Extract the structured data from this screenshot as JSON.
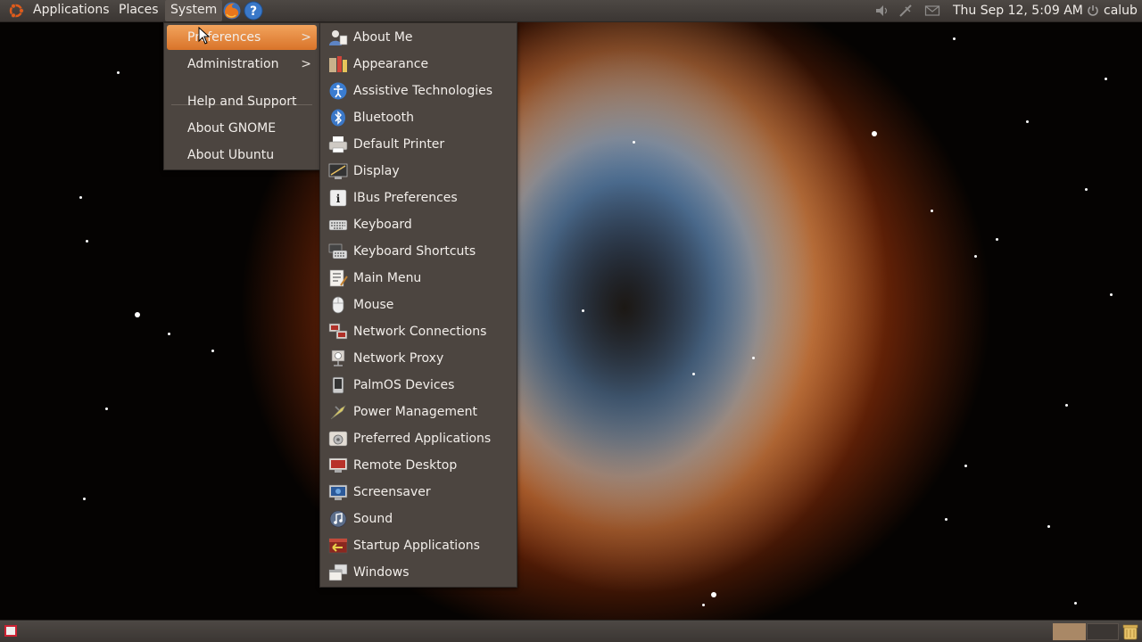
{
  "top_panel": {
    "menus": {
      "applications": "Applications",
      "places": "Places",
      "system": "System"
    },
    "clock": "Thu Sep 12,  5:09 AM",
    "user": "calub"
  },
  "system_menu": {
    "items": [
      {
        "label": "Preferences",
        "has_submenu": true,
        "highlighted": true
      },
      {
        "label": "Administration",
        "has_submenu": true
      },
      {
        "label": "Help and Support"
      },
      {
        "label": "About GNOME"
      },
      {
        "label": "About Ubuntu"
      }
    ],
    "submenu_arrow": ">"
  },
  "preferences_menu": {
    "items": [
      {
        "label": "About Me",
        "icon": "user-icon"
      },
      {
        "label": "Appearance",
        "icon": "appearance-icon"
      },
      {
        "label": "Assistive Technologies",
        "icon": "accessibility-icon"
      },
      {
        "label": "Bluetooth",
        "icon": "bluetooth-icon"
      },
      {
        "label": "Default Printer",
        "icon": "printer-icon"
      },
      {
        "label": "Display",
        "icon": "display-icon"
      },
      {
        "label": "IBus Preferences",
        "icon": "ibus-icon"
      },
      {
        "label": "Keyboard",
        "icon": "keyboard-icon"
      },
      {
        "label": "Keyboard Shortcuts",
        "icon": "keyboard-shortcuts-icon"
      },
      {
        "label": "Main Menu",
        "icon": "main-menu-icon"
      },
      {
        "label": "Mouse",
        "icon": "mouse-icon"
      },
      {
        "label": "Network Connections",
        "icon": "network-connections-icon"
      },
      {
        "label": "Network Proxy",
        "icon": "network-proxy-icon"
      },
      {
        "label": "PalmOS Devices",
        "icon": "palm-device-icon"
      },
      {
        "label": "Power Management",
        "icon": "power-management-icon"
      },
      {
        "label": "Preferred Applications",
        "icon": "preferred-apps-icon"
      },
      {
        "label": "Remote Desktop",
        "icon": "remote-desktop-icon"
      },
      {
        "label": "Screensaver",
        "icon": "screensaver-icon"
      },
      {
        "label": "Sound",
        "icon": "sound-icon"
      },
      {
        "label": "Startup Applications",
        "icon": "startup-apps-icon"
      },
      {
        "label": "Windows",
        "icon": "windows-icon"
      }
    ]
  },
  "colors": {
    "panel": "#3b3633",
    "menu_bg": "#4c4540",
    "highlight": "#e08c3e",
    "menu_text": "#f2eeea"
  }
}
